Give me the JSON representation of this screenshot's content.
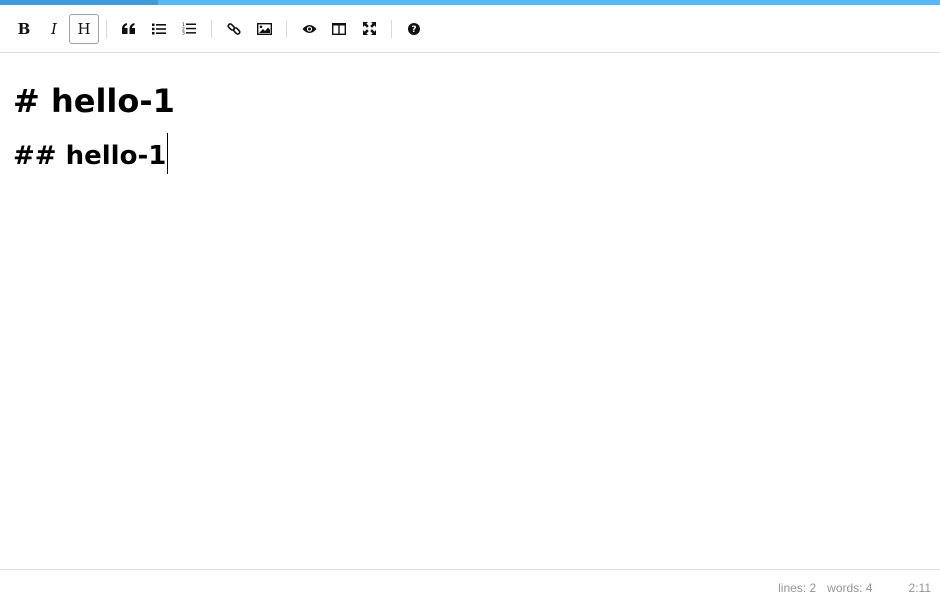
{
  "toolbar": {
    "buttons": [
      {
        "id": "bold",
        "glyph": "B",
        "icon": "bold-icon"
      },
      {
        "id": "italic",
        "glyph": "I",
        "icon": "italic-icon"
      },
      {
        "id": "heading",
        "glyph": "H",
        "icon": "heading-icon",
        "active": true
      },
      {
        "id": "quote",
        "icon": "quote-icon"
      },
      {
        "id": "unordered-list",
        "icon": "unordered-list-icon"
      },
      {
        "id": "ordered-list",
        "icon": "ordered-list-icon"
      },
      {
        "id": "link",
        "icon": "link-icon"
      },
      {
        "id": "image",
        "icon": "image-icon"
      },
      {
        "id": "preview",
        "icon": "eye-icon"
      },
      {
        "id": "side-by-side",
        "icon": "columns-icon"
      },
      {
        "id": "fullscreen",
        "icon": "fullscreen-icon"
      },
      {
        "id": "guide",
        "icon": "question-icon"
      }
    ]
  },
  "editor": {
    "lines": [
      "# hello-1",
      "## hello-1"
    ]
  },
  "status": {
    "lines_label": "lines: 2",
    "words_label": "words: 4",
    "cursor": "2:11"
  },
  "colors": {
    "progress_bar": "#58b7f6",
    "status_text": "#959595",
    "icon": "#2c3e50"
  }
}
